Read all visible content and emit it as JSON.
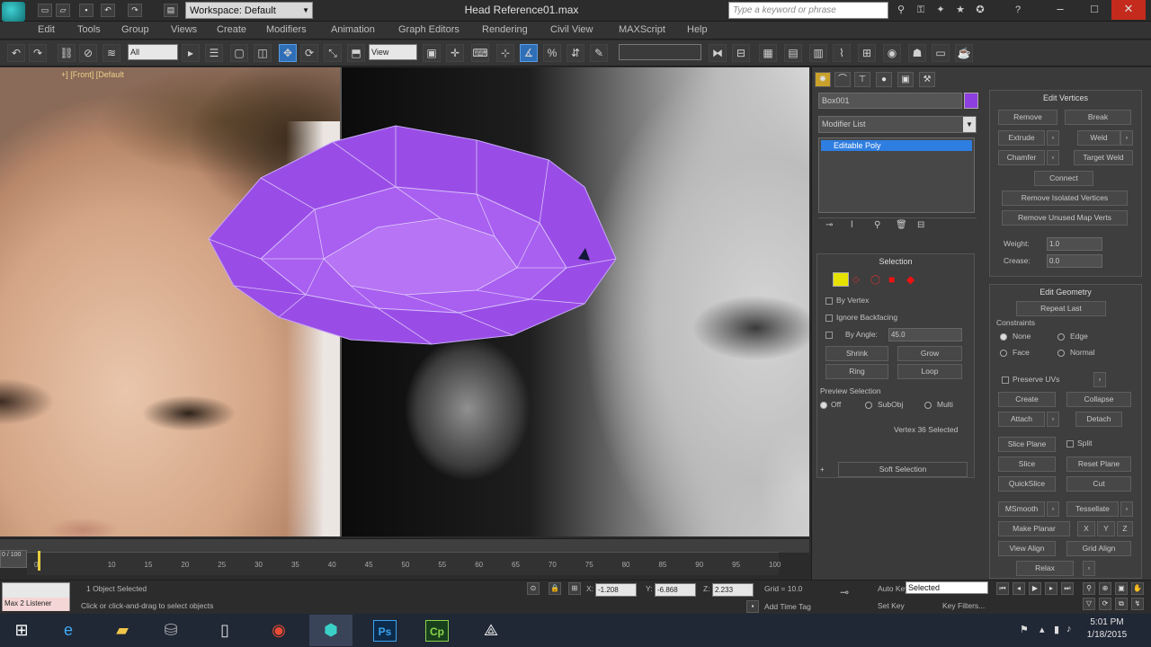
{
  "titlebar": {
    "workspace": "Workspace: Default",
    "window_title": "Head Reference01.max",
    "search_placeholder": "Type a keyword or phrase"
  },
  "menu": [
    "Edit",
    "Tools",
    "Group",
    "Views",
    "Create",
    "Modifiers",
    "Animation",
    "Graph Editors",
    "Rendering",
    "Civil View",
    "MAXScript",
    "Help"
  ],
  "toolbar": {
    "selection_filter": "All",
    "ref_coord": "View"
  },
  "viewport_labels": {
    "left": "+] [Front] [Default",
    "right": ""
  },
  "command_panel": {
    "object_name": "Box001",
    "object_color": "#8e3fe0",
    "modifier_list": "Modifier List",
    "stack_item": "Editable Poly",
    "edit_vertices": {
      "title": "Edit Vertices",
      "buttons": [
        "Remove",
        "Break",
        "Extrude",
        "Weld",
        "Chamfer",
        "Target Weld",
        "Connect",
        "Remove Isolated Vertices",
        "Remove Unused Map Verts"
      ],
      "weight_label": "Weight:",
      "weight_value": "1.0",
      "crease_label": "Crease:",
      "crease_value": "0.0"
    },
    "selection": {
      "title": "Selection",
      "by_vertex": "By Vertex",
      "ignore_backfacing": "Ignore Backfacing",
      "by_angle": "By Angle:",
      "by_angle_value": "45.0",
      "shrink": "Shrink",
      "grow": "Grow",
      "ring": "Ring",
      "loop": "Loop",
      "preview_label": "Preview Selection",
      "preview_options": [
        "Off",
        "SubObj",
        "Multi"
      ],
      "status": "Vertex 36 Selected"
    },
    "soft_selection": "Soft Selection",
    "edit_geometry": {
      "title": "Edit Geometry",
      "repeat_last": "Repeat Last",
      "constraints": "Constraints",
      "constraint_options": [
        "None",
        "Edge",
        "Face",
        "Normal"
      ],
      "preserve_uvs": "Preserve UVs",
      "create": "Create",
      "collapse": "Collapse",
      "attach": "Attach",
      "detach": "Detach",
      "slice_plane": "Slice Plane",
      "split": "Split",
      "slice": "Slice",
      "reset_plane": "Reset Plane",
      "quickslice": "QuickSlice",
      "cut": "Cut",
      "msmooth": "MSmooth",
      "tessellate": "Tessellate",
      "make_planar": "Make Planar",
      "xyz": [
        "X",
        "Y",
        "Z"
      ],
      "view_align": "View Align",
      "grid_align": "Grid Align",
      "relax": "Relax"
    }
  },
  "timeline": {
    "slider": "0 / 100",
    "ticks": [
      "0",
      "10",
      "15",
      "20",
      "25",
      "30",
      "35",
      "40",
      "45",
      "50",
      "55",
      "60",
      "65",
      "70",
      "75",
      "80",
      "85",
      "90",
      "95",
      "100"
    ]
  },
  "status": {
    "maxscript": "Max 2 Listener",
    "selected": "1 Object Selected",
    "prompt": "Click or click-and-drag to select objects",
    "x": "-1.208",
    "y": "-6.868",
    "z": "2.233",
    "grid": "Grid = 10.0",
    "autokey": "Auto Key",
    "setkey": "Set Key",
    "selection_set": "Selected",
    "key_filters": "Key Filters...",
    "add_time_tag": "Add Time Tag"
  },
  "taskbar": {
    "time": "5:01 PM",
    "date": "1/18/2015",
    "apps": [
      "Windows",
      "Internet Explorer",
      "File Explorer",
      "Network",
      "Notepad",
      "Chrome",
      "3ds Max",
      "Photoshop",
      "Captivate",
      "Unity"
    ]
  }
}
